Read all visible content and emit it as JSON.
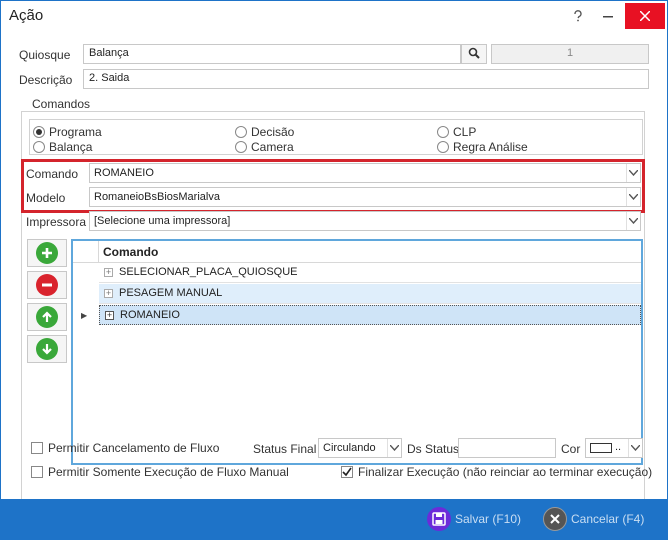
{
  "window": {
    "title": "Ação"
  },
  "form": {
    "quiosque_label": "Quiosque",
    "quiosque_value": "Balança",
    "quiosque_code": "1",
    "descricao_label": "Descrição",
    "descricao_value": "2. Saida"
  },
  "comandos": {
    "group_label": "Comandos",
    "options": [
      {
        "label": "Programa",
        "checked": true
      },
      {
        "label": "Balança",
        "checked": false
      },
      {
        "label": "Decisão",
        "checked": false
      },
      {
        "label": "Camera",
        "checked": false
      },
      {
        "label": "CLP",
        "checked": false
      },
      {
        "label": "Regra Análise",
        "checked": false
      }
    ]
  },
  "selects": {
    "comando_label": "Comando",
    "comando_value": "ROMANEIO",
    "modelo_label": "Modelo",
    "modelo_value": "RomaneioBsBiosMarialva",
    "impressora_label": "Impressora",
    "impressora_value": "[Selecione uma impressora]"
  },
  "grid": {
    "header": "Comando",
    "rows": [
      {
        "label": "SELECIONAR_PLACA_QUIOSQUE"
      },
      {
        "label": "PESAGEM MANUAL"
      },
      {
        "label": "ROMANEIO"
      }
    ]
  },
  "bottom": {
    "permitir_cancelamento": "Permitir Cancelamento de Fluxo",
    "status_final_label": "Status Final",
    "status_final_value": "Circulando",
    "ds_status_label": "Ds Status",
    "ds_status_value": "",
    "cor_label": "Cor",
    "cor_value": "..",
    "permitir_somente": "Permitir Somente Execução de Fluxo Manual",
    "finalizar": "Finalizar Execução (não reinciar ao terminar execução)"
  },
  "footer": {
    "save_label": "Salvar (F10)",
    "cancel_label": "Cancelar (F4)"
  },
  "colors": {
    "accent": "#1e73c8",
    "highlight_border": "#d4242c",
    "add": "#3aa83a",
    "remove": "#d9232d",
    "save_icon": "#6c2bd9"
  }
}
